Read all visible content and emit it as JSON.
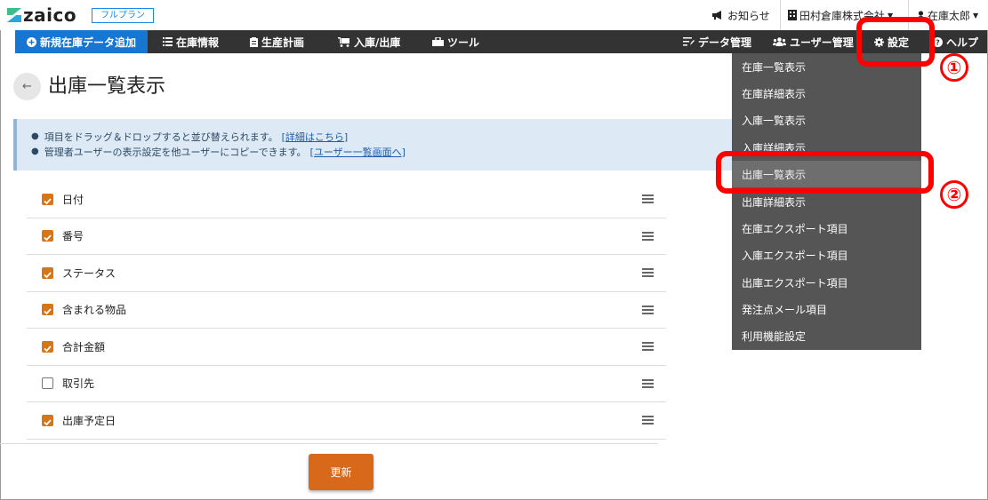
{
  "header": {
    "logo_text": "zaico",
    "plan_badge": "フルプラン",
    "notice": "お知らせ",
    "company": "田村倉庫株式会社",
    "user": "在庫太郎"
  },
  "nav": {
    "new_item": "新規在庫データ追加",
    "inventory": "在庫情報",
    "production": "生産計画",
    "in_out": "入庫/出庫",
    "tools": "ツール",
    "data_mgmt": "データ管理",
    "user_mgmt": "ユーザー管理",
    "settings": "設定",
    "help": "ヘルプ"
  },
  "page": {
    "title": "出庫一覧表示"
  },
  "info": {
    "line1": "項目をドラッグ＆ドロップすると並び替えられます。",
    "line1_link": "[詳細はこちら]",
    "line2": "管理者ユーザーの表示設定を他ユーザーにコピーできます。",
    "line2_link": "[ユーザー一覧画面へ]"
  },
  "fields": [
    {
      "label": "日付",
      "checked": true
    },
    {
      "label": "番号",
      "checked": true
    },
    {
      "label": "ステータス",
      "checked": true
    },
    {
      "label": "含まれる物品",
      "checked": true
    },
    {
      "label": "合計金額",
      "checked": true
    },
    {
      "label": "取引先",
      "checked": false
    },
    {
      "label": "出庫予定日",
      "checked": true
    }
  ],
  "update_button": "更新",
  "dropdown": {
    "items": [
      "在庫一覧表示",
      "在庫詳細表示",
      "入庫一覧表示",
      "入庫詳細表示",
      "出庫一覧表示",
      "出庫詳細表示",
      "在庫エクスポート項目",
      "入庫エクスポート項目",
      "出庫エクスポート項目",
      "発注点メール項目",
      "利用機能設定"
    ],
    "active_index": 4
  },
  "annotations": {
    "mark1": "①",
    "mark2": "②"
  },
  "colors": {
    "accent_blue": "#1776d2",
    "navbar": "#333333",
    "checkbox": "#d67617",
    "update_button": "#d8691a",
    "dropdown": "#555555",
    "annotation": "#ff0000"
  }
}
